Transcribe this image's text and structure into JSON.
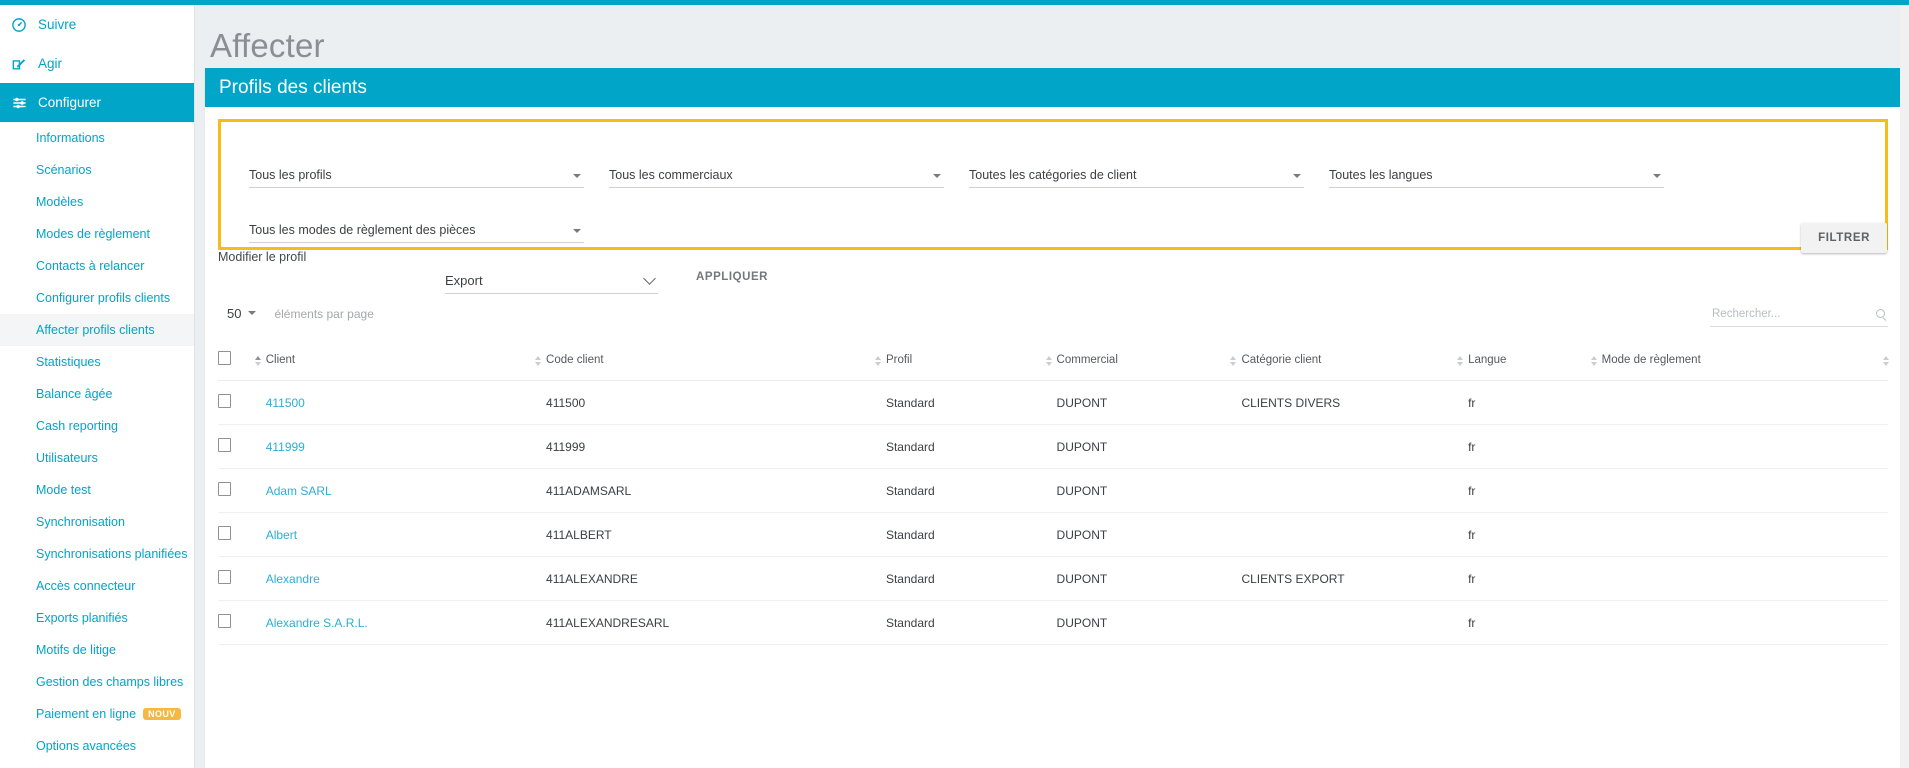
{
  "page": {
    "title": "Affecter",
    "panel_title": "Profils des clients"
  },
  "sidebar": {
    "main_items": [
      {
        "label": "Suivre",
        "icon": "gauge-icon",
        "active": false
      },
      {
        "label": "Agir",
        "icon": "pencil-square-icon",
        "active": false
      },
      {
        "label": "Configurer",
        "icon": "sliders-icon",
        "active": true
      }
    ],
    "sub_items": [
      {
        "label": "Informations",
        "selected": false,
        "badge": ""
      },
      {
        "label": "Scénarios",
        "selected": false,
        "badge": ""
      },
      {
        "label": "Modèles",
        "selected": false,
        "badge": ""
      },
      {
        "label": "Modes de règlement",
        "selected": false,
        "badge": ""
      },
      {
        "label": "Contacts à relancer",
        "selected": false,
        "badge": ""
      },
      {
        "label": "Configurer profils clients",
        "selected": false,
        "badge": ""
      },
      {
        "label": "Affecter profils clients",
        "selected": true,
        "badge": ""
      },
      {
        "label": "Statistiques",
        "selected": false,
        "badge": ""
      },
      {
        "label": "Balance âgée",
        "selected": false,
        "badge": ""
      },
      {
        "label": "Cash reporting",
        "selected": false,
        "badge": ""
      },
      {
        "label": "Utilisateurs",
        "selected": false,
        "badge": ""
      },
      {
        "label": "Mode test",
        "selected": false,
        "badge": ""
      },
      {
        "label": "Synchronisation",
        "selected": false,
        "badge": ""
      },
      {
        "label": "Synchronisations planifiées",
        "selected": false,
        "badge": ""
      },
      {
        "label": "Accès connecteur",
        "selected": false,
        "badge": ""
      },
      {
        "label": "Exports planifiés",
        "selected": false,
        "badge": ""
      },
      {
        "label": "Motifs de litige",
        "selected": false,
        "badge": ""
      },
      {
        "label": "Gestion des champs libres",
        "selected": false,
        "badge": ""
      },
      {
        "label": "Paiement en ligne",
        "selected": false,
        "badge": "NOUV"
      },
      {
        "label": "Options avancées",
        "selected": false,
        "badge": ""
      }
    ]
  },
  "filters": {
    "highlight_color": "#f5bc1c",
    "selects": [
      {
        "value": "Tous les profils"
      },
      {
        "value": "Tous les commerciaux"
      },
      {
        "value": "Toutes les catégories de client"
      },
      {
        "value": "Toutes les langues"
      },
      {
        "value": "Tous les modes de règlement des pièces"
      }
    ],
    "filter_button": "FILTRER"
  },
  "actions": {
    "modify_label": "Modifier le profil",
    "export_value": "Export",
    "apply_button": "APPLIQUER"
  },
  "pagination": {
    "per_page_value": "50",
    "per_page_label": "éléments par page"
  },
  "search": {
    "placeholder": "Rechercher...",
    "value": ""
  },
  "table": {
    "columns": [
      {
        "label": "Client",
        "sortable": true,
        "sorted": "asc"
      },
      {
        "label": "Code client",
        "sortable": true,
        "sorted": ""
      },
      {
        "label": "Profil",
        "sortable": true,
        "sorted": ""
      },
      {
        "label": "Commercial",
        "sortable": true,
        "sorted": ""
      },
      {
        "label": "Catégorie client",
        "sortable": true,
        "sorted": ""
      },
      {
        "label": "Langue",
        "sortable": true,
        "sorted": ""
      },
      {
        "label": "Mode de règlement",
        "sortable": true,
        "sorted": ""
      }
    ],
    "rows": [
      {
        "client": "411500",
        "code": "411500",
        "profil": "Standard",
        "commercial": "DUPONT",
        "categorie": "CLIENTS DIVERS",
        "langue": "fr",
        "mode": ""
      },
      {
        "client": "411999",
        "code": "411999",
        "profil": "Standard",
        "commercial": "DUPONT",
        "categorie": "",
        "langue": "fr",
        "mode": ""
      },
      {
        "client": "Adam SARL",
        "code": "411ADAMSARL",
        "profil": "Standard",
        "commercial": "DUPONT",
        "categorie": "",
        "langue": "fr",
        "mode": ""
      },
      {
        "client": "Albert",
        "code": "411ALBERT",
        "profil": "Standard",
        "commercial": "DUPONT",
        "categorie": "",
        "langue": "fr",
        "mode": ""
      },
      {
        "client": "Alexandre",
        "code": "411ALEXANDRE",
        "profil": "Standard",
        "commercial": "DUPONT",
        "categorie": "CLIENTS EXPORT",
        "langue": "fr",
        "mode": ""
      },
      {
        "client": "Alexandre S.A.R.L.",
        "code": "411ALEXANDRESARL",
        "profil": "Standard",
        "commercial": "DUPONT",
        "categorie": "",
        "langue": "fr",
        "mode": ""
      }
    ]
  },
  "theme": {
    "accent": "#00a5c8",
    "link": "#2eaed4",
    "highlight": "#f5bc1c",
    "badge": "#f5b942"
  }
}
